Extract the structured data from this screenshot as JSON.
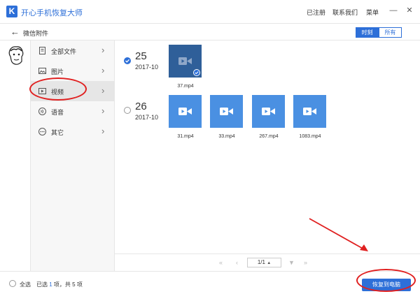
{
  "app": {
    "logo_letter": "K",
    "title": "开心手机恢复大师"
  },
  "topbar": {
    "registered": "已注册",
    "contact": "联系我们",
    "menu": "菜单"
  },
  "subbar": {
    "title": "微信附件",
    "toggle_time": "时刻",
    "toggle_all": "所有"
  },
  "sidebar": {
    "items": [
      {
        "label": "全部文件",
        "icon": "document-icon"
      },
      {
        "label": "图片",
        "icon": "image-icon"
      },
      {
        "label": "视频",
        "icon": "video-icon"
      },
      {
        "label": "语音",
        "icon": "audio-icon"
      },
      {
        "label": "其它",
        "icon": "more-icon"
      }
    ]
  },
  "groups": [
    {
      "day": "25",
      "month": "2017-10",
      "checked": true,
      "files": [
        {
          "name": "37.mp4",
          "selected": true
        }
      ]
    },
    {
      "day": "26",
      "month": "2017-10",
      "checked": false,
      "files": [
        {
          "name": "31.mp4",
          "selected": false
        },
        {
          "name": "33.mp4",
          "selected": false
        },
        {
          "name": "267.mp4",
          "selected": false
        },
        {
          "name": "1083.mp4",
          "selected": false
        }
      ]
    }
  ],
  "pager": {
    "page": "1/1"
  },
  "footer": {
    "select_all": "全选",
    "summary_prefix": "已选",
    "selected_count": "1",
    "summary_mid": "项，共",
    "total_count": "5",
    "summary_suffix": "项",
    "recover_button": "恢复到电脑"
  },
  "colors": {
    "accent": "#2d6fd8",
    "thumb": "#4a90e2",
    "thumb_selected": "#2f5f99",
    "annotation": "#e02020"
  }
}
